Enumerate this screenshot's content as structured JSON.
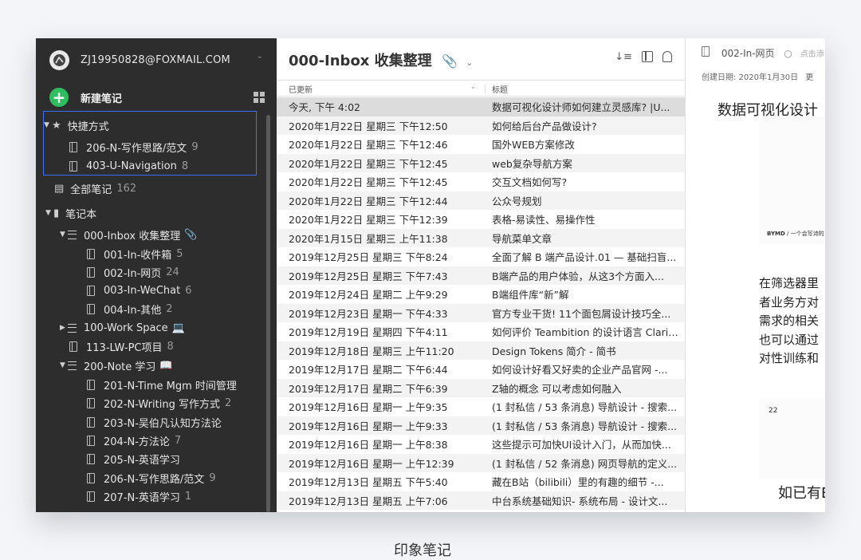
{
  "colors": {
    "accent_green": "#2dbe60",
    "highlight_border": "#3a72ff",
    "sidebar_bg": "#2d2d2d"
  },
  "account": {
    "email": "ZJ19950828@FOXMAIL.COM",
    "icon": "avatar-logo"
  },
  "new_note": {
    "label": "新建笔记"
  },
  "sidebar": {
    "shortcuts": {
      "label": "快捷方式",
      "items": [
        {
          "label": "206-N-写作思路/范文",
          "count": "9"
        },
        {
          "label": "403-U-Navigation",
          "count": "8"
        }
      ]
    },
    "all_notes": {
      "label": "全部笔记",
      "count": "162"
    },
    "notebooks": {
      "label": "笔记本"
    },
    "stack_inbox": {
      "label": "000-Inbox 收集整理",
      "icon": "paperclip-icon"
    },
    "inbox_items": [
      {
        "label": "001-In-收件箱",
        "count": "5"
      },
      {
        "label": "002-In-网页",
        "count": "24"
      },
      {
        "label": "003-In-WeChat",
        "count": "6"
      },
      {
        "label": "004-In-其他",
        "count": "2"
      }
    ],
    "stack_work": {
      "label": "100-Work Space",
      "icon": "laptop-icon"
    },
    "project": {
      "label": "113-LW-PC项目",
      "count": "8"
    },
    "stack_note": {
      "label": "200-Note 学习",
      "icon": "book-icon"
    },
    "note_items": [
      {
        "label": "201-N-Time Mgm 时间管理",
        "count": ""
      },
      {
        "label": "202-N-Writing 写作方式",
        "count": "2"
      },
      {
        "label": "203-N-吴伯凡认知方法论",
        "count": ""
      },
      {
        "label": "204-N-方法论",
        "count": "7"
      },
      {
        "label": "205-N-英语学习",
        "count": ""
      },
      {
        "label": "206-N-写作思路/范文",
        "count": "9"
      },
      {
        "label": "207-N-英语学习",
        "count": "1"
      }
    ]
  },
  "list": {
    "title": "000-Inbox 收集整理",
    "col_updated": "已更新",
    "col_title": "标题",
    "rows": [
      {
        "date": "今天, 下午 4:02",
        "title": "数据可视化设计师如何建立灵感库? |U..."
      },
      {
        "date": "2020年1月22日 星期三 下午12:50",
        "title": "如何给后台产品做设计?"
      },
      {
        "date": "2020年1月22日 星期三 下午12:46",
        "title": "国外WEB方案修改"
      },
      {
        "date": "2020年1月22日 星期三 下午12:45",
        "title": "web复杂导航方案"
      },
      {
        "date": "2020年1月22日 星期三 下午12:45",
        "title": "交互文档如何写?"
      },
      {
        "date": "2020年1月22日 星期三 下午12:44",
        "title": "公众号规划"
      },
      {
        "date": "2020年1月22日 星期三 下午12:39",
        "title": "表格-易读性、易操作性"
      },
      {
        "date": "2020年1月15日 星期三 上午11:38",
        "title": "导航菜单文章"
      },
      {
        "date": "2019年12月25日 星期三 下午8:24",
        "title": "全面了解 B 端产品设计.01 — 基础扫盲..."
      },
      {
        "date": "2019年12月25日 星期三 下午7:43",
        "title": "B端产品的用户体验，从这3个方面入..."
      },
      {
        "date": "2019年12月24日 星期二 上午9:29",
        "title": "B端组件库“新”解"
      },
      {
        "date": "2019年12月23日 星期一 下午4:33",
        "title": "官方专业干货! 11个面包屑设计技巧全..."
      },
      {
        "date": "2019年12月19日 星期四 下午4:11",
        "title": "如何评价 Teambition 的设计语言 Clarit..."
      },
      {
        "date": "2019年12月18日 星期三 上午11:20",
        "title": "Design Tokens 简介 - 简书"
      },
      {
        "date": "2019年12月17日 星期二 下午6:44",
        "title": "如何设计好看又好卖的企业产品官网 -..."
      },
      {
        "date": "2019年12月17日 星期二 下午6:39",
        "title": "Z轴的概念 可以考虑如何融入"
      },
      {
        "date": "2019年12月16日 星期一 上午9:35",
        "title": "(1 封私信 / 53 条消息) 导航设计 - 搜索..."
      },
      {
        "date": "2019年12月16日 星期一 上午9:33",
        "title": "(1 封私信 / 53 条消息) 导航设计 - 搜索..."
      },
      {
        "date": "2019年12月16日 星期一 上午8:38",
        "title": "这些提示可加快UI设计入门，从而加快..."
      },
      {
        "date": "2019年12月16日 星期一 上午12:39",
        "title": "(1 封私信 / 52 条消息) 网页导航的定义..."
      },
      {
        "date": "2019年12月13日 星期五 下午5:40",
        "title": "藏在B站（bilibili）里的有趣的细节 -..."
      },
      {
        "date": "2019年12月13日 星期五 上午7:06",
        "title": "中台系统基础知识- 系统布局 - 设计文..."
      }
    ]
  },
  "note": {
    "notebook": "002-In-网页",
    "add_tag": "点击添",
    "created": "创建日期: 2020年1月30日",
    "created_tail": "更",
    "heading": "数据可视化设计",
    "image_brand": "BYMD",
    "image_caption": "/ 一个会写诗的",
    "para": [
      "在筛选器里",
      "者业务方对",
      "需求的相关",
      "也可以通过",
      "对性训练和"
    ],
    "small_number": "22",
    "footer_text": "如已有E"
  },
  "page_caption": "印象笔记"
}
